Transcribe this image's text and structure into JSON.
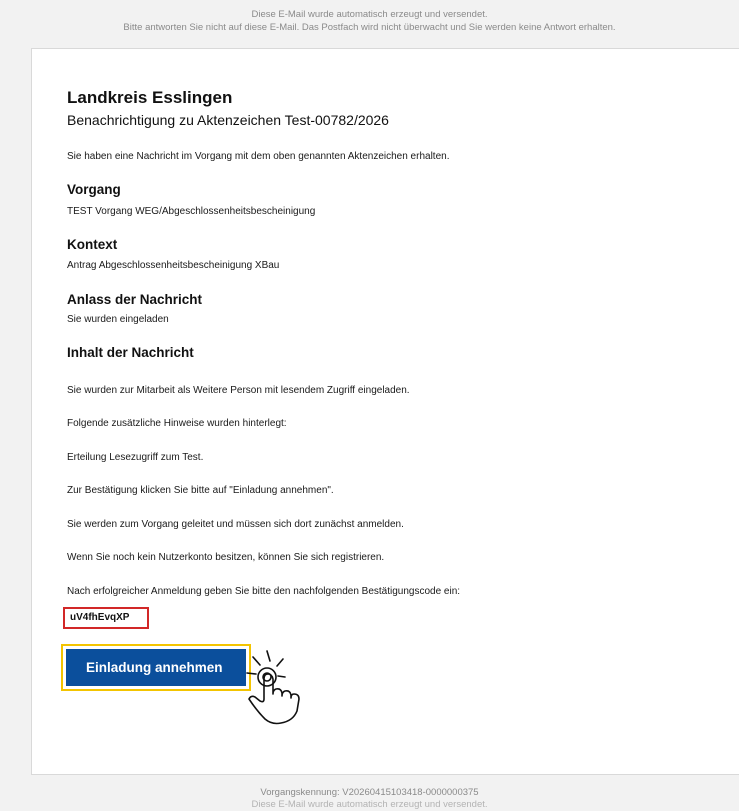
{
  "preheader": {
    "line1": "Diese E-Mail wurde automatisch erzeugt und versendet.",
    "line2": "Bitte antworten Sie nicht auf diese E-Mail. Das Postfach wird nicht überwacht und Sie werden keine Antwort erhalten."
  },
  "header": {
    "title": "Landkreis Esslingen",
    "subtitle": "Benachrichtigung zu Aktenzeichen Test-00782/2026"
  },
  "intro": "Sie haben eine Nachricht im Vorgang mit dem oben genannten Aktenzeichen erhalten.",
  "sections": {
    "vorgang": {
      "heading": "Vorgang",
      "value": "TEST Vorgang WEG/Abgeschlossenheitsbescheinigung"
    },
    "kontext": {
      "heading": "Kontext",
      "value": "Antrag Abgeschlossenheitsbescheinigung XBau"
    },
    "anlass": {
      "heading": "Anlass der Nachricht",
      "value": "Sie wurden eingeladen"
    },
    "inhalt": {
      "heading": "Inhalt der Nachricht"
    }
  },
  "message": {
    "p1": "Sie wurden zur Mitarbeit als Weitere Person mit lesendem Zugriff eingeladen.",
    "p2": "Folgende zusätzliche Hinweise wurden hinterlegt:",
    "p3": "Erteilung Lesezugriff zum Test.",
    "p4": "Zur Bestätigung klicken Sie bitte auf \"Einladung annehmen\".",
    "p5": "Sie werden zum Vorgang geleitet und müssen sich dort zunächst anmelden.",
    "p6": "Wenn Sie noch kein Nutzerkonto besitzen, können Sie sich registrieren.",
    "p7": "Nach erfolgreicher Anmeldung geben Sie bitte den nachfolgenden Bestätigungscode ein:",
    "code": "uV4fhEvqXP"
  },
  "action": {
    "button_label": "Einladung annehmen"
  },
  "footer": {
    "line1": "Vorgangskennung: V20260415103418-0000000375",
    "line2": "Diese E-Mail wurde automatisch erzeugt und versendet."
  },
  "colors": {
    "button_bg": "#0b4f9c",
    "button_highlight": "#f3c400",
    "code_highlight": "#d22828"
  }
}
